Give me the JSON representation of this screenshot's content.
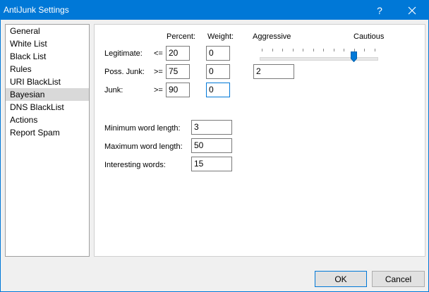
{
  "window": {
    "title": "AntiJunk Settings",
    "help_glyph": "?",
    "accent_color": "#0078d7"
  },
  "nav": {
    "items": [
      {
        "label": "General",
        "selected": false
      },
      {
        "label": "White List",
        "selected": false
      },
      {
        "label": "Black List",
        "selected": false
      },
      {
        "label": "Rules",
        "selected": false
      },
      {
        "label": "URI BlackList",
        "selected": false
      },
      {
        "label": "Bayesian",
        "selected": true
      },
      {
        "label": "DNS BlackList",
        "selected": false
      },
      {
        "label": "Actions",
        "selected": false
      },
      {
        "label": "Report Spam",
        "selected": false
      }
    ]
  },
  "bayesian": {
    "col_percent": "Percent:",
    "col_weight": "Weight:",
    "rows": [
      {
        "label": "Legitimate:",
        "op": "<=",
        "percent": "20",
        "weight": "0"
      },
      {
        "label": "Poss. Junk:",
        "op": ">=",
        "percent": "75",
        "weight": "0"
      },
      {
        "label": "Junk:",
        "op": ">=",
        "percent": "90",
        "weight": "0"
      }
    ],
    "slider": {
      "left_label": "Aggressive",
      "right_label": "Cautious",
      "value_text": "2",
      "position_fraction": 0.81
    },
    "min_word_label": "Minimum word length:",
    "min_word_value": "3",
    "max_word_label": "Maximum word length:",
    "max_word_value": "50",
    "interesting_label": "Interesting words:",
    "interesting_value": "15"
  },
  "buttons": {
    "ok": "OK",
    "cancel": "Cancel"
  }
}
